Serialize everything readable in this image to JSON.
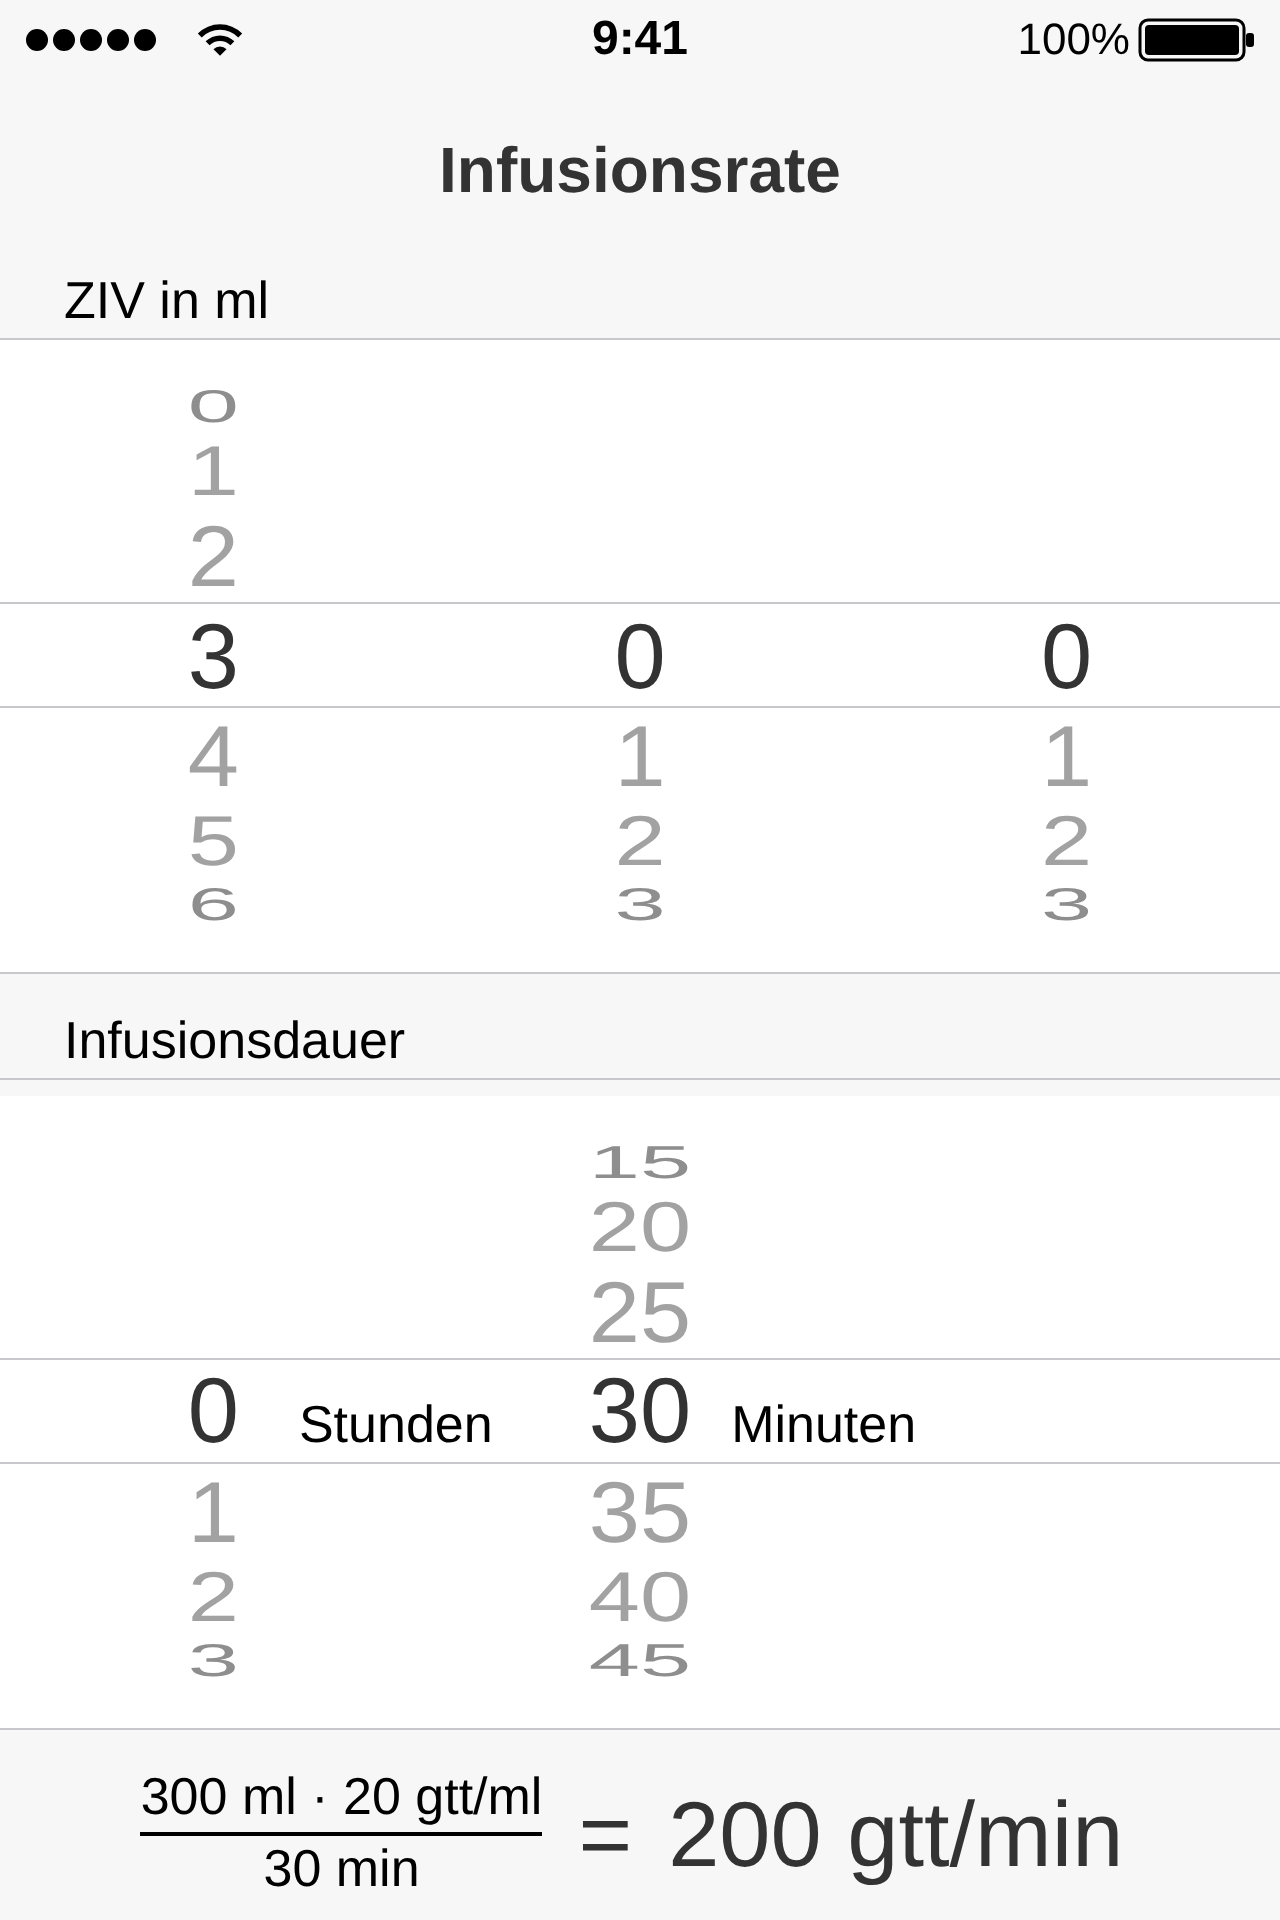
{
  "status_bar": {
    "time": "9:41",
    "battery": "100%"
  },
  "navigation": {
    "title": "Infusionsrate"
  },
  "sections": [
    {
      "header": "ZIV in ml",
      "picker": {
        "columns": [
          {
            "items": [
              {
                "text": "0",
                "selected": false
              },
              {
                "text": "1",
                "selected": false
              },
              {
                "text": "2",
                "selected": false
              },
              {
                "text": "3",
                "selected": true
              },
              {
                "text": "4",
                "selected": false
              },
              {
                "text": "5",
                "selected": false
              },
              {
                "text": "6",
                "selected": false
              }
            ]
          },
          {
            "items": [
              {
                "text": "0",
                "selected": true
              },
              {
                "text": "1",
                "selected": false
              },
              {
                "text": "2",
                "selected": false
              },
              {
                "text": "3",
                "selected": false
              }
            ]
          },
          {
            "items": [
              {
                "text": "0",
                "selected": true
              },
              {
                "text": "1",
                "selected": false
              },
              {
                "text": "2",
                "selected": false
              },
              {
                "text": "3",
                "selected": false
              }
            ]
          }
        ]
      }
    },
    {
      "header": "Infusionsdauer",
      "picker": {
        "columns": [
          {
            "items": [
              {
                "text": "0",
                "selected": true
              },
              {
                "text": "1",
                "selected": false
              },
              {
                "text": "2",
                "selected": false
              },
              {
                "text": "3",
                "selected": false
              }
            ],
            "unit": "Stunden"
          },
          {
            "items": [
              {
                "text": "15",
                "selected": false
              },
              {
                "text": "20",
                "selected": false
              },
              {
                "text": "25",
                "selected": false
              },
              {
                "text": "30",
                "selected": true
              },
              {
                "text": "35",
                "selected": false
              },
              {
                "text": "40",
                "selected": false
              },
              {
                "text": "45",
                "selected": false
              }
            ],
            "unit": "Minuten"
          }
        ]
      }
    }
  ],
  "result": {
    "numerator": "300 ml · 20 gtt/ml",
    "denominator": "30 min",
    "operator": "=",
    "value": "200 gtt/min"
  }
}
